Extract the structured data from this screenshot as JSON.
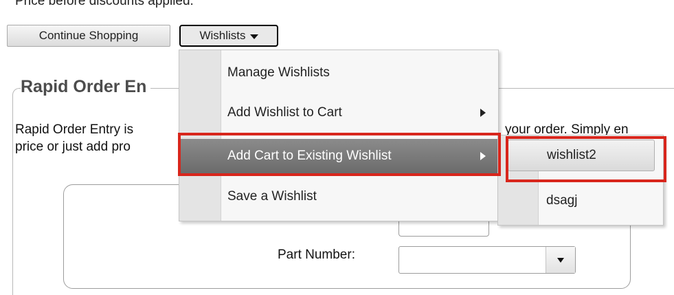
{
  "page": {
    "price_note": "Price before discounts applied."
  },
  "toolbar": {
    "continue_label": "Continue Shopping",
    "wishlists_label": "Wishlists"
  },
  "rapid_order": {
    "title": "Rapid Order En",
    "desc_line1": "Rapid Order Entry is",
    "desc_line2": "price or just add pro",
    "desc_right": "your order. Simply en",
    "part_number_label": "Part Number:"
  },
  "wishlist_menu": {
    "items": [
      {
        "label": "Manage Wishlists",
        "has_submenu": false
      },
      {
        "label": "Add Wishlist to Cart",
        "has_submenu": true
      },
      {
        "label": "Add Cart to Existing Wishlist",
        "has_submenu": true
      },
      {
        "label": "Save a Wishlist",
        "has_submenu": false
      }
    ]
  },
  "submenu": {
    "items": [
      {
        "label": "wishlist2"
      },
      {
        "label": "dsagj"
      }
    ]
  },
  "colors": {
    "highlight": "#d8261c",
    "menu_active_bg": "#7b7b7b"
  }
}
